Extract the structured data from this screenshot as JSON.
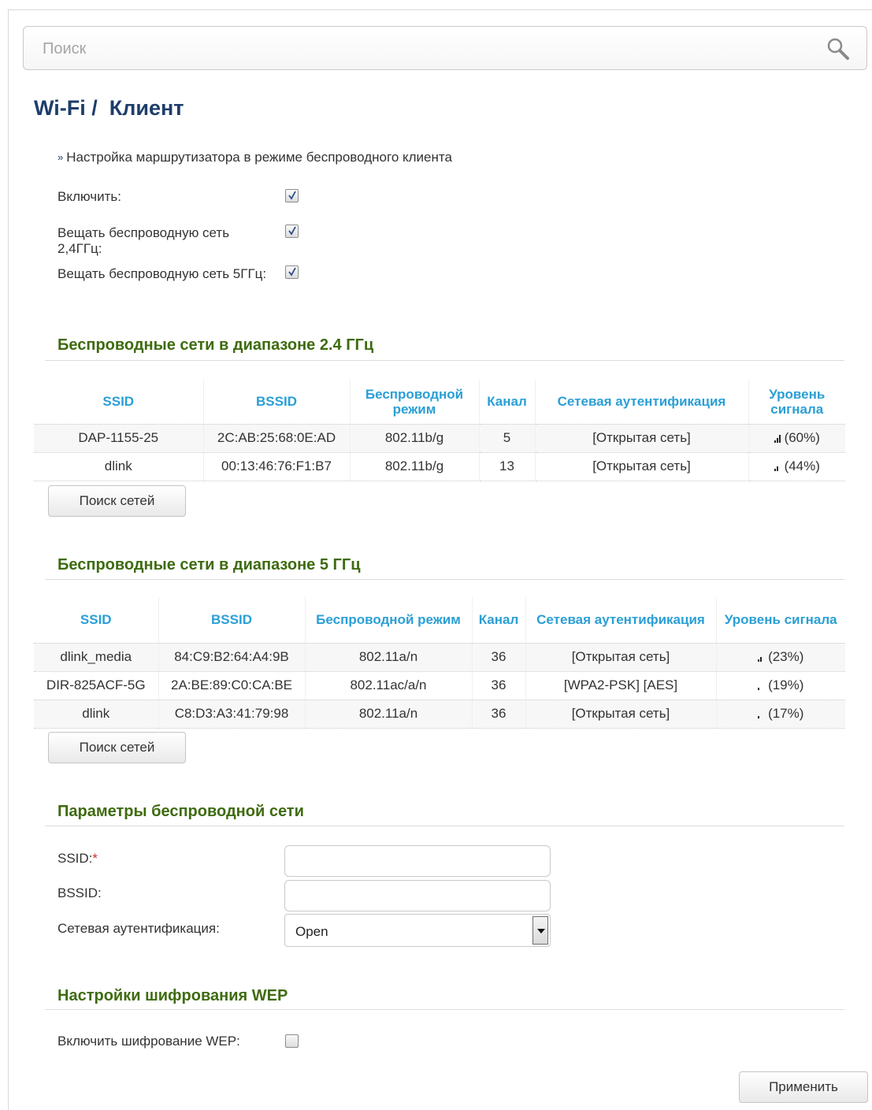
{
  "search": {
    "placeholder": "Поиск"
  },
  "page": {
    "title": "Wi-Fi /  Клиент",
    "subtitle": "Настройка маршрутизатора в режиме беспроводного клиента"
  },
  "general": {
    "enable_label": "Включить:",
    "enable_checked": true,
    "broadcast24_label": "Вещать беспроводную сеть 2,4ГГц:",
    "broadcast24_checked": true,
    "broadcast5_label": "Вещать беспроводную сеть 5ГГц:",
    "broadcast5_checked": true
  },
  "networks24": {
    "title": "Беспроводные сети в диапазоне 2.4 ГГц",
    "headers": [
      "SSID",
      "BSSID",
      "Беспроводной режим",
      "Канал",
      "Сетевая аутентификация",
      "Уровень сигнала"
    ],
    "rows": [
      {
        "ssid": "DAP-1155-25",
        "bssid": "2C:AB:25:68:0E:AD",
        "mode": "802.11b/g",
        "channel": "5",
        "auth": "[Открытая сеть]",
        "signal": "(60%)",
        "signal_level": 60
      },
      {
        "ssid": "dlink",
        "bssid": "00:13:46:76:F1:B7",
        "mode": "802.11b/g",
        "channel": "13",
        "auth": "[Открытая сеть]",
        "signal": "(44%)",
        "signal_level": 44
      }
    ],
    "scan_button": "Поиск сетей"
  },
  "networks5": {
    "title": "Беспроводные сети в диапазоне 5 ГГц",
    "headers": [
      "SSID",
      "BSSID",
      "Беспроводной режим",
      "Канал",
      "Сетевая аутентификация",
      "Уровень сигнала"
    ],
    "rows": [
      {
        "ssid": "dlink_media",
        "bssid": "84:C9:B2:64:A4:9B",
        "mode": "802.11a/n",
        "channel": "36",
        "auth": "[Открытая сеть]",
        "signal": "(23%)",
        "signal_level": 23
      },
      {
        "ssid": "DIR-825ACF-5G",
        "bssid": "2A:BE:89:C0:CA:BE",
        "mode": "802.11ac/a/n",
        "channel": "36",
        "auth": "[WPA2-PSK] [AES]",
        "signal": "(19%)",
        "signal_level": 19
      },
      {
        "ssid": "dlink",
        "bssid": "C8:D3:A3:41:79:98",
        "mode": "802.11a/n",
        "channel": "36",
        "auth": "[Открытая сеть]",
        "signal": "(17%)",
        "signal_level": 17
      }
    ],
    "scan_button": "Поиск сетей"
  },
  "params": {
    "title": "Параметры беспроводной сети",
    "ssid_label": "SSID:",
    "required_mark": "*",
    "ssid_value": "",
    "bssid_label": "BSSID:",
    "bssid_value": "",
    "auth_label": "Сетевая аутентификация:",
    "auth_value": "Open"
  },
  "wep": {
    "title": "Настройки шифрования WEP",
    "enable_label": "Включить шифрование WEP:",
    "enable_checked": false
  },
  "apply_button": "Применить",
  "icons": {
    "search": "search-icon",
    "check": "check-icon",
    "signal": "signal-bars-icon",
    "dropdown": "chevron-down-icon"
  }
}
